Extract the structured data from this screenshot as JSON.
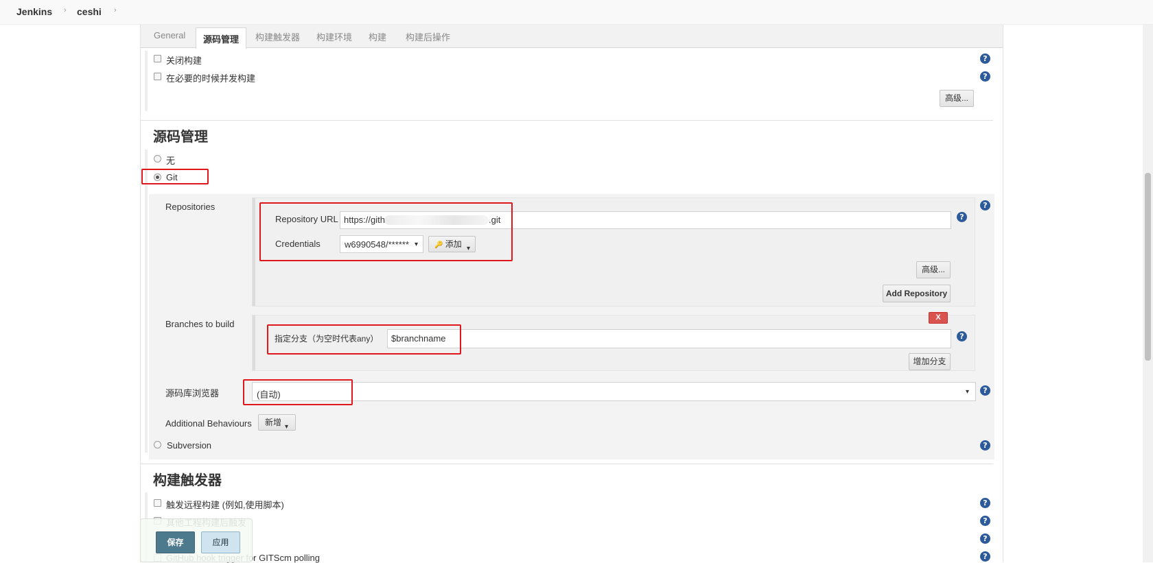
{
  "breadcrumb": {
    "items": [
      "Jenkins",
      "ceshi"
    ],
    "separator": "›"
  },
  "tabs": {
    "items": [
      "General",
      "源码管理",
      "构建触发器",
      "构建环境",
      "构建",
      "构建后操作"
    ],
    "active": "源码管理"
  },
  "general": {
    "disable_build": "关闭构建",
    "concurrent_build": "在必要的时候并发构建",
    "advanced_label": "高级..."
  },
  "scm": {
    "section_title": "源码管理",
    "option_none": "无",
    "option_git": "Git",
    "selected": "Git",
    "repositories_label": "Repositories",
    "repo_url_label": "Repository URL",
    "repo_url_value_start": "https://githu",
    "repo_url_value_end": ".git",
    "credentials_label": "Credentials",
    "credentials_value": "w6990548/******",
    "add_credentials_label": "添加",
    "repo_advanced_label": "高级...",
    "add_repository_label": "Add Repository",
    "branches_label": "Branches to build",
    "branch_specifier_label": "指定分支（为空时代表any）",
    "branch_specifier_value": "$branchname",
    "delete_branch_label": "X",
    "add_branch_label": "增加分支",
    "repo_browser_label": "源码库浏览器",
    "repo_browser_value": "(自动)",
    "additional_behaviours_label": "Additional Behaviours",
    "add_behaviour_label": "新增",
    "option_subversion": "Subversion"
  },
  "triggers": {
    "section_title": "构建触发器",
    "remote_trigger": "触发远程构建 (例如,使用脚本)",
    "after_other_projects": "其他工程构建后触发",
    "github_hook": "GitHub hook trigger for GITScm polling"
  },
  "bottom_bar": {
    "save_label": "保存",
    "apply_label": "应用"
  },
  "icons": {
    "help": "?",
    "caret": "▾",
    "key": "🔑"
  },
  "colors": {
    "highlight_box": "#e0161b",
    "help_icon": "#2d5a9a",
    "save_button": "#4e7a8e",
    "delete_button": "#d9534f"
  }
}
